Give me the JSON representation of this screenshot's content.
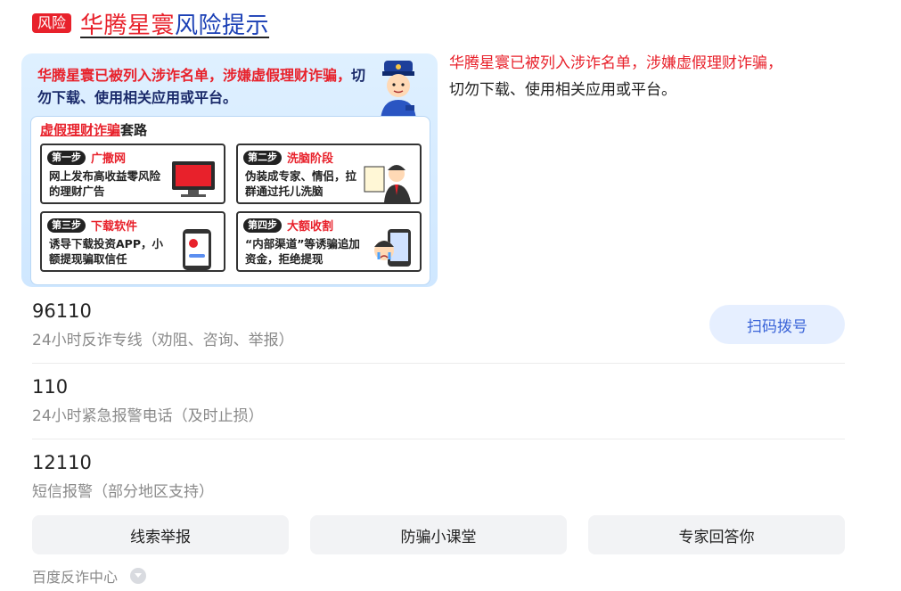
{
  "header": {
    "badge": "风险",
    "title_red": "华腾星寰",
    "title_blue": "风险提示"
  },
  "poster": {
    "headline_red": "华腾星寰已被列入涉诈名单，涉嫌虚假理财诈骗，",
    "headline_dark": "切勿下载、使用相关应用或平台。",
    "section_title_red": "虚假理财诈骗",
    "section_title_dark": "套路",
    "steps": [
      {
        "tag": "第一步",
        "name": "广撒网",
        "desc": "网上发布高收益零风险的理财广告"
      },
      {
        "tag": "第二步",
        "name": "洗脑阶段",
        "desc": "伪装成专家、情侣，拉群通过托儿洗脑"
      },
      {
        "tag": "第三步",
        "name": "下载软件",
        "desc": "诱导下载投资APP，小额提现骗取信任"
      },
      {
        "tag": "第四步",
        "name": "大额收割",
        "desc": "“内部渠道”等诱骗追加资金，拒绝提现"
      }
    ]
  },
  "warning": {
    "red": "华腾星寰已被列入涉诈名单，涉嫌虚假理财诈骗，",
    "dark": "切勿下载、使用相关应用或平台。"
  },
  "phones": [
    {
      "number": "96110",
      "desc": "24小时反诈专线（劝阻、咨询、举报）"
    },
    {
      "number": "110",
      "desc": "24小时紧急报警电话（及时止损）"
    },
    {
      "number": "12110",
      "desc": "短信报警（部分地区支持）"
    }
  ],
  "scan_button": "扫码拨号",
  "buttons": {
    "report": "线索举报",
    "class": "防骗小课堂",
    "expert": "专家回答你"
  },
  "footer": {
    "label": "百度反诈中心"
  },
  "colors": {
    "red": "#e8212b",
    "blue": "#1a3fb5",
    "accent": "#3a64d8"
  }
}
